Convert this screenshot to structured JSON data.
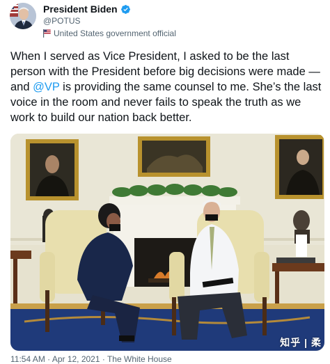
{
  "tweet": {
    "display_name": "President Biden",
    "handle": "@POTUS",
    "account_label": "United States government official",
    "text_before": "When I served as Vice President, I asked to be the last person with the President before big decisions were made — and ",
    "mention": "@VP",
    "text_after": " is providing the same counsel to me. She’s the last voice in the room and never fails to speak the truth as we work to build our nation back better.",
    "meta": "11:54 AM · Apr 12, 2021 · The White House"
  },
  "watermark": "知乎 | 柔",
  "colors": {
    "accent": "#1d9bf0",
    "text_primary": "#0f1419",
    "text_secondary": "#536471"
  },
  "icons": {
    "verified": "verified-badge-icon",
    "account_label": "us-flag-icon"
  }
}
